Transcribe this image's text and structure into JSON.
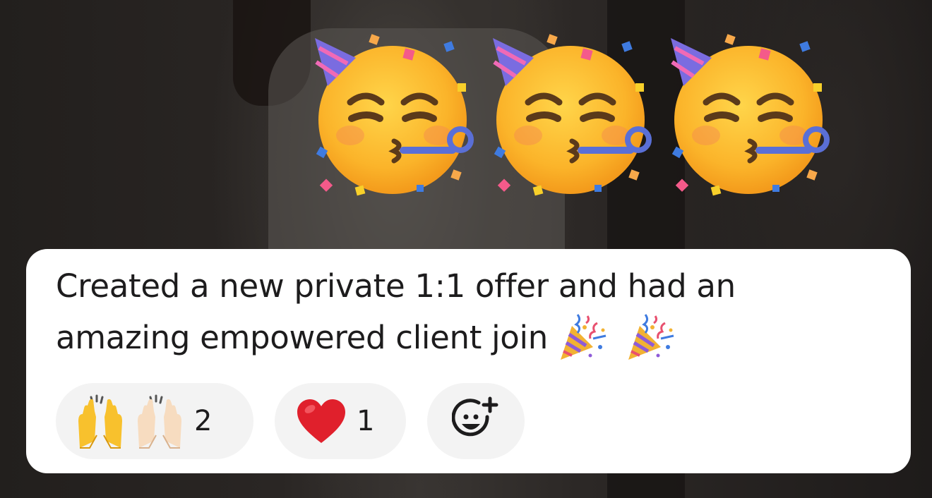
{
  "message": {
    "line_1": "Created a new private 1:1 offer and had an",
    "line_2": "amazing empowered client join",
    "trailing_emojis": [
      "party-popper",
      "party-popper"
    ]
  },
  "big_emojis": [
    "partying-face",
    "partying-face",
    "partying-face"
  ],
  "reactions": [
    {
      "emojis": [
        "raising-hands",
        "raising-hands-light"
      ],
      "count": "2"
    },
    {
      "emojis": [
        "red-heart"
      ],
      "count": "1"
    }
  ],
  "add_reaction_icon": "add-reaction-icon",
  "colors": {
    "card_background": "#ffffff",
    "reaction_pill_background": "#f3f3f3",
    "text": "#1d1c1d",
    "heart": "#e0202c"
  }
}
